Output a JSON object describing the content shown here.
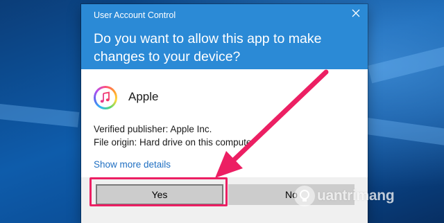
{
  "window": {
    "title": "User Account Control",
    "close_icon": "close-icon"
  },
  "dialog": {
    "question": "Do you want to allow this app to make changes to your device?",
    "app_name": "Apple",
    "app_icon": "itunes-icon",
    "publisher": "Verified publisher: Apple Inc.",
    "origin": "File origin: Hard drive on this computer",
    "details_link": "Show more details"
  },
  "buttons": {
    "yes": "Yes",
    "no": "No"
  },
  "annotation": {
    "arrow_color": "#ec1f63",
    "highlight_color": "#ec1f63"
  },
  "watermark": {
    "text": "uantrimang",
    "logo_icon": "lightbulb-icon"
  },
  "colors": {
    "header": "#2b8ad6",
    "link": "#1f6fc2",
    "button": "#cccccc"
  }
}
